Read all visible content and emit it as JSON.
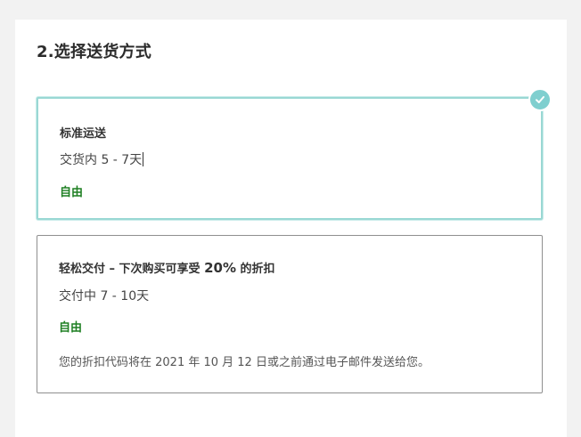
{
  "section": {
    "title": "2.选择送货方式"
  },
  "options": [
    {
      "title": "标准运送",
      "time_prefix": "交货内",
      "time_range": " 5 - 7天",
      "price": "自由",
      "selected": true
    },
    {
      "title_before": "轻松交付 – 下次购买可享受 ",
      "title_discount": "20%",
      "title_after": " 的折扣",
      "time_prefix": "交付中",
      "time_range": " 7 - 10天",
      "price": "自由",
      "note": "您的折扣代码将在 2021 年 10 月 12 日或之前通过电子邮件发送给您。",
      "selected": false
    }
  ],
  "icons": {
    "selected_check": "check-circle-icon"
  },
  "colors": {
    "selected_border": "#9ad8d4",
    "check_badge": "#7fcfcf",
    "price_green": "#1e7f22",
    "unselected_border": "#8f8f8f"
  }
}
